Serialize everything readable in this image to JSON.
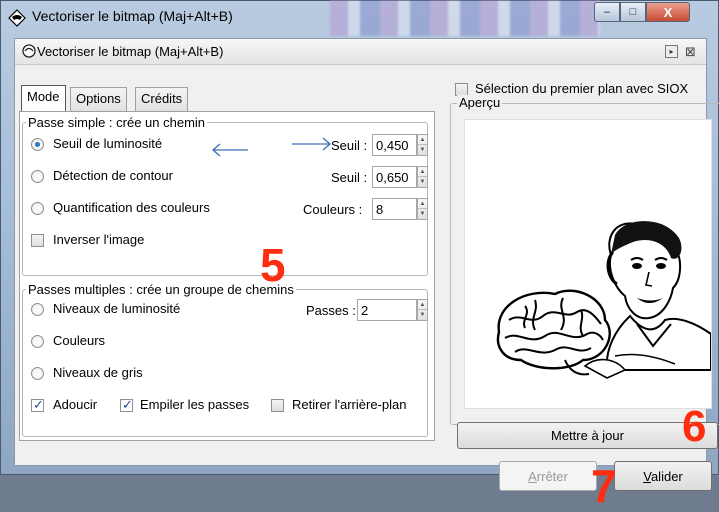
{
  "window": {
    "title": "Vectoriser le bitmap (Maj+Alt+B)",
    "minimize": "–",
    "maximize": "□",
    "close": "X"
  },
  "dock": {
    "title": "Vectoriser le bitmap (Maj+Alt+B)",
    "btn1": "▸",
    "btn2": "⊠"
  },
  "tabs": [
    {
      "label": "Mode",
      "active": true
    },
    {
      "label": "Options",
      "active": false
    },
    {
      "label": "Crédits",
      "active": false
    }
  ],
  "single_pass": {
    "legend": "Passe simple : crée un chemin",
    "options": [
      {
        "label": "Seuil de luminosité",
        "selected": true,
        "param_label": "Seuil :",
        "param_value": "0,450"
      },
      {
        "label": "Détection de contour",
        "selected": false,
        "param_label": "Seuil :",
        "param_value": "0,650"
      },
      {
        "label": "Quantification des couleurs",
        "selected": false,
        "param_label": "Couleurs :",
        "param_value": "8"
      }
    ],
    "invert": {
      "label": "Inverser l'image",
      "checked": false
    }
  },
  "multi_pass": {
    "legend": "Passes multiples : crée un groupe de chemins",
    "options": [
      {
        "label": "Niveaux de luminosité",
        "selected": false
      },
      {
        "label": "Couleurs",
        "selected": false
      },
      {
        "label": "Niveaux de gris",
        "selected": false
      }
    ],
    "passes_label": "Passes :",
    "passes_value": "2",
    "smooth": {
      "label": "Adoucir",
      "checked": true
    },
    "stack": {
      "label": "Empiler les passes",
      "checked": true
    },
    "remove_bg": {
      "label": "Retirer l'arrière-plan",
      "checked": false
    }
  },
  "siox": {
    "label": "Sélection du premier plan avec SIOX",
    "checked": false
  },
  "preview": {
    "legend": "Aperçu"
  },
  "buttons": {
    "update": "Mettre à jour",
    "stop_first": "A",
    "stop_rest": "rrêter",
    "ok_first": "V",
    "ok_rest": "alider"
  },
  "annotations": {
    "a5": "5",
    "a6": "6",
    "a7": "7"
  },
  "colors": {
    "annotation": "#ff2d10",
    "arrow": "#3b6fb6"
  }
}
